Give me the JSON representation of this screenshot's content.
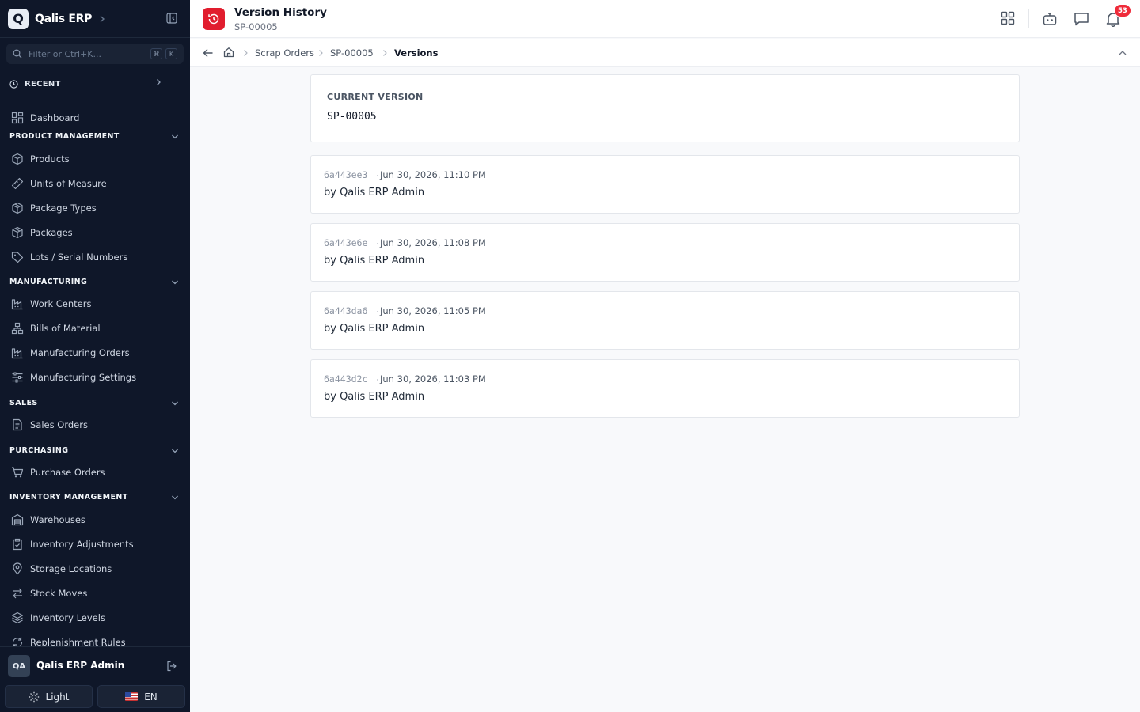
{
  "sidebar": {
    "brand": {
      "logo_letter": "Q",
      "name": "Qalis ERP"
    },
    "search": {
      "placeholder": "Filter or Ctrl+K...",
      "kbd1": "⌘",
      "kbd2": "K"
    },
    "recent_label": "RECENT",
    "dashboard_label": "Dashboard",
    "sections": [
      {
        "title": "PRODUCT MANAGEMENT",
        "items": [
          "Products",
          "Units of Measure",
          "Package Types",
          "Packages",
          "Lots / Serial Numbers"
        ]
      },
      {
        "title": "MANUFACTURING",
        "items": [
          "Work Centers",
          "Bills of Material",
          "Manufacturing Orders",
          "Manufacturing Settings"
        ]
      },
      {
        "title": "SALES",
        "items": [
          "Sales Orders"
        ]
      },
      {
        "title": "PURCHASING",
        "items": [
          "Purchase Orders"
        ]
      },
      {
        "title": "INVENTORY MANAGEMENT",
        "items": [
          "Warehouses",
          "Inventory Adjustments",
          "Storage Locations",
          "Stock Moves",
          "Inventory Levels",
          "Replenishment Rules"
        ]
      }
    ],
    "user": {
      "initials": "QA",
      "name": "Qalis ERP Admin"
    },
    "theme_label": "Light",
    "lang_label": "EN"
  },
  "header": {
    "title": "Version History",
    "subtitle": "SP-00005",
    "notification_count": "53"
  },
  "breadcrumb": [
    "Scrap Orders",
    "SP-00005",
    "Versions"
  ],
  "current_version": {
    "label": "CURRENT VERSION",
    "value": "SP-00005"
  },
  "versions": [
    {
      "hash": "6a443ee3",
      "date": "Jun 30, 2026, 11:10 PM",
      "author": "by Qalis ERP Admin"
    },
    {
      "hash": "6a443e6e",
      "date": "Jun 30, 2026, 11:08 PM",
      "author": "by Qalis ERP Admin"
    },
    {
      "hash": "6a443da6",
      "date": "Jun 30, 2026, 11:05 PM",
      "author": "by Qalis ERP Admin"
    },
    {
      "hash": "6a443d2c",
      "date": "Jun 30, 2026, 11:03 PM",
      "author": "by Qalis ERP Admin"
    }
  ],
  "colors": {
    "sidebar_bg": "#0f1729",
    "accent": "#e11d2e",
    "badge": "#ef2b3a"
  }
}
